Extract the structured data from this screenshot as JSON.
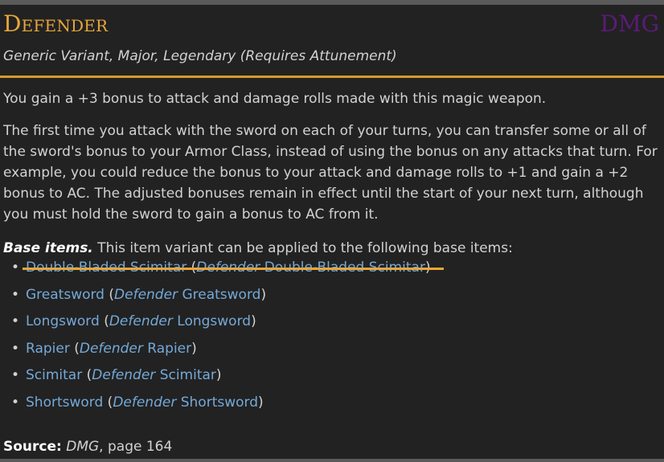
{
  "item": {
    "title": "Defender",
    "source_tag": "DMG",
    "subtitle": "Generic Variant, Major, Legendary (Requires Attunement)"
  },
  "description": {
    "p1": "You gain a +3 bonus to attack and damage rolls made with this magic weapon.",
    "p2": "The first time you attack with the sword on each of your turns, you can transfer some or all of the sword's bonus to your Armor Class, instead of using the bonus on any attacks that turn. For example, you could reduce the bonus to your attack and damage rolls to +1 and gain a +2 bonus to AC. The adjusted bonuses remain in effect until the start of your next turn, although you must hold the sword to gain a bonus to AC from it."
  },
  "base_items": {
    "label": "Base items.",
    "text": " This item variant can be applied to the following base items:",
    "items": [
      {
        "base": "Double-Bladed Scimitar",
        "prefix": "Defender",
        "variant": "Double-Bladed Scimitar",
        "struck": true
      },
      {
        "base": "Greatsword",
        "prefix": "Defender",
        "variant": "Greatsword",
        "struck": false
      },
      {
        "base": "Longsword",
        "prefix": "Defender",
        "variant": "Longsword",
        "struck": false
      },
      {
        "base": "Rapier",
        "prefix": "Defender",
        "variant": "Rapier",
        "struck": false
      },
      {
        "base": "Scimitar",
        "prefix": "Defender",
        "variant": "Scimitar",
        "struck": false
      },
      {
        "base": "Shortsword",
        "prefix": "Defender",
        "variant": "Shortsword",
        "struck": false
      }
    ]
  },
  "source": {
    "label": "Source:",
    "book": "DMG",
    "page": ", page 164"
  }
}
